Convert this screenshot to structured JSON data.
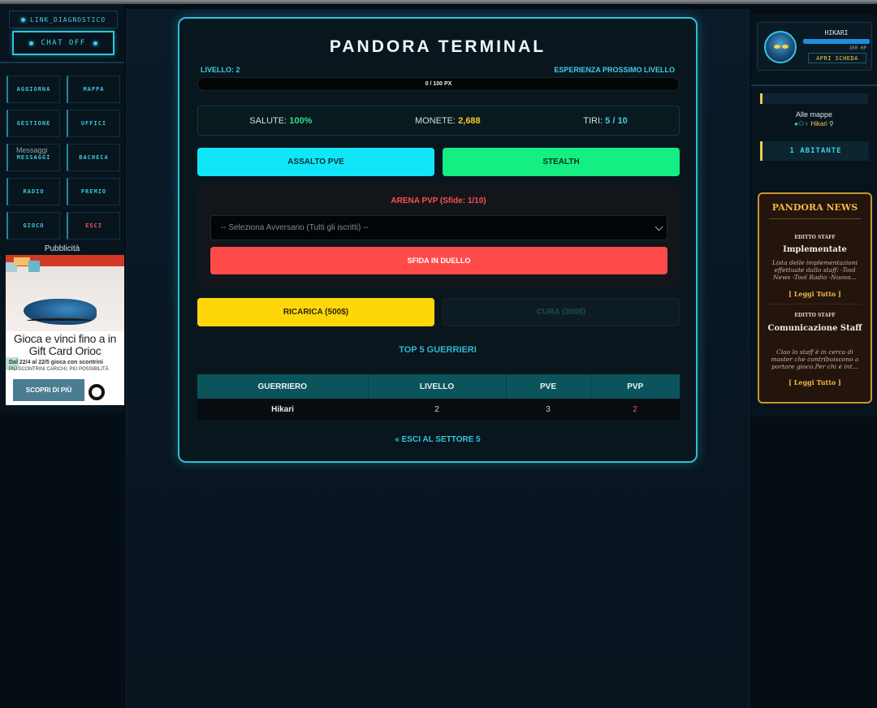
{
  "left_panel": {
    "link_label": "LINK_DIAGNOSTICO",
    "chat_label": "CHAT OFF",
    "nav": [
      {
        "label": "AGGIORNA",
        "danger": false
      },
      {
        "label": "MAPPA",
        "danger": false
      },
      {
        "label": "GESTIONE",
        "danger": false
      },
      {
        "label": "UFFICI",
        "danger": false
      },
      {
        "label": "MESSAGGI",
        "danger": false,
        "overlay": "Messaggi"
      },
      {
        "label": "BACHECA",
        "danger": false
      },
      {
        "label": "RADIO",
        "danger": false
      },
      {
        "label": "PREMIO",
        "danger": false
      },
      {
        "label": "GIOCO",
        "danger": false
      },
      {
        "label": "ESCI",
        "danger": true
      }
    ],
    "ad_label": "Pubblicità",
    "ad": {
      "title": "Gioca e vinci fino a in Gift Card Orioc",
      "subtitle": "Dal 22/4 al 22/5 gioca con scontrini",
      "subtitle2": "PIÙ SCONTRINI CARICHI, PIÙ POSSIBILITÀ",
      "cta": "SCOPRI DI PIÙ",
      "logo": "ric"
    }
  },
  "terminal": {
    "title": "PANDORA TERMINAL",
    "level_label": "LIVELLO: 2",
    "exp_label": "ESPERIENZA PROSSIMO LIVELLO",
    "xp_text": "0 / 100 PX",
    "xp_progress": 0,
    "stats": {
      "salute_label": "SALUTE:",
      "salute_value": "100%",
      "monete_label": "MONETE:",
      "monete_value": "2,688",
      "tiri_label": "TIRI:",
      "tiri_value": "5 / 10"
    },
    "btn_pve": "ASSALTO PVE",
    "btn_stealth": "STEALTH",
    "arena": {
      "title": "ARENA PVP (Sfide: 1/10)",
      "select_value": "-- Seleziona Avversario (Tutti gli iscritti) --",
      "duel_button": "SFIDA IN DUELLO"
    },
    "btn_ricarica": "RICARICA (500$)",
    "btn_cura": "CURA (200$)",
    "top5_title": "TOP 5 GUERRIERI",
    "table": {
      "headers": [
        "GUERRIERO",
        "LIVELLO",
        "PVE",
        "PVP"
      ],
      "rows": [
        [
          "Hikari",
          "2",
          "3",
          "2"
        ]
      ]
    },
    "exit_link": "« ESCI AL SETTORE 5"
  },
  "right_panel": {
    "profile": {
      "name": "HIKARI",
      "hp_text": "100 HP",
      "sheet_button": "APRI SCHEDA"
    },
    "maps_label": "Alle mappe",
    "maps_user": "Hikari",
    "inhabitants": "1 ABITANTE",
    "news": {
      "title": "PANDORA NEWS",
      "items": [
        {
          "tag": "EDITTO STAFF",
          "headline": "Implementate",
          "body": "Lista delle implementazioni effettuate dallo staff: -Tool News -Tool Radio -Nuova...",
          "link": "[ Leggi Tutto ]"
        },
        {
          "tag": "EDITTO STAFF",
          "headline": "Comunicazione Staff",
          "body": "Ciao lo staff è in cerca di master che contribuiscono a portare gioco.Per chi è int...",
          "link": "[ Leggi Tutto ]"
        }
      ]
    }
  }
}
